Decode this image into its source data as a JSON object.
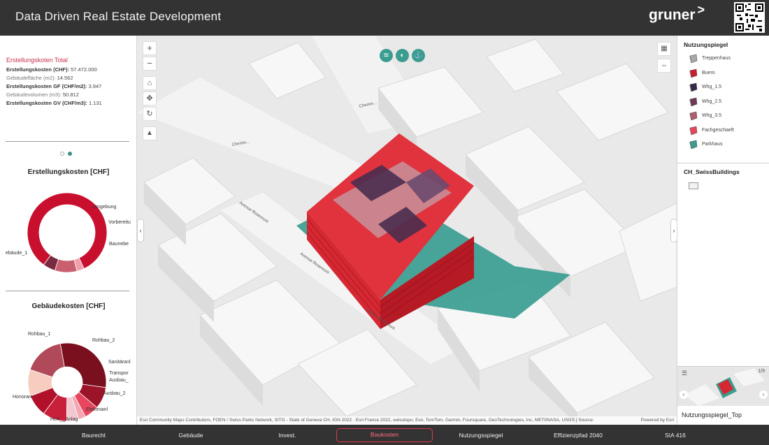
{
  "header": {
    "title": "Data Driven Real Estate Development",
    "logo": "gruner",
    "logo_chevron": ">"
  },
  "stats": {
    "title": "Erstellungskoten Total",
    "rows": [
      {
        "label": "Erstellungskosten (CHF):",
        "value": "57.472.000",
        "bold": true
      },
      {
        "label": "Gebäudefläche (m2):",
        "value": "14.562",
        "bold": false
      },
      {
        "label": "Erstellungskosten GF (CHF/m2):",
        "value": "3.947",
        "bold": true
      },
      {
        "label": "Gebäudevolumen (m3):",
        "value": "50.812",
        "bold": false
      },
      {
        "label": "Erstellungskosten GV (CHF/m3):",
        "value": "1.131",
        "bold": true
      }
    ]
  },
  "charts": {
    "erstellung": {
      "title": "Erstellungskosten [CHF]",
      "labels": [
        "Umgebung",
        "Vorbereitu",
        "Baunebe",
        "ebäude_1"
      ]
    },
    "gebaeude": {
      "title": "Gebäudekosten [CHF]",
      "labels": [
        "Rohbau_1",
        "Rohbau_2",
        "Sanitäranl",
        "Transpor",
        "Ausbau_",
        "Ausbau_2",
        "Elektroanl",
        "HLK__Anlag",
        "Honorare"
      ]
    }
  },
  "chart_data": [
    {
      "type": "pie",
      "title": "Erstellungskosten [CHF]",
      "categories": [
        "Gebäude_1",
        "Umgebung",
        "Vorbereitu",
        "Baunebe"
      ],
      "values": [
        83,
        3,
        9,
        5
      ],
      "colors": [
        "#c8102e",
        "#f0a0aa",
        "#c86070",
        "#7a2a40"
      ]
    },
    {
      "type": "pie",
      "title": "Gebäudekosten [CHF]",
      "categories": [
        "Rohbau_1",
        "Rohbau_2",
        "Sanitäranl",
        "Transpor",
        "Ausbau_",
        "Ausbau_2",
        "Elektroanl",
        "HLK__Anlag",
        "Honorare"
      ],
      "values": [
        30,
        9,
        6,
        3,
        5,
        10,
        9,
        11,
        17
      ],
      "colors": [
        "#7a0f1e",
        "#9b1428",
        "#e8465e",
        "#f5a6b2",
        "#f2c8cf",
        "#c8203a",
        "#b0102a",
        "#f6cdbf",
        "#b04a5a"
      ]
    }
  ],
  "map": {
    "top_tools": [
      "layers-icon",
      "compass-rose-icon",
      "anchor-icon"
    ],
    "streets": [
      "Avenue Rosemont",
      "Avenue Rosemont",
      "Avenue Rosemont",
      "Chemin...",
      "Chemin..."
    ],
    "attribution": "Esri Community Maps Contributors, FOEN / Swiss Parks Network, SITG - State of Geneva CH, IGN 2022 · Esri France 2022, swisstopo, Esri, TomTom, Garmin, Foursquare, GeoTechnologies, Inc, METI/NASA, USGS | Source:",
    "powered_by": "Powered by Esri"
  },
  "legend": {
    "title": "Nutzungspiegel",
    "items": [
      {
        "label": "Treppenhaus",
        "color": "#a8a8a8"
      },
      {
        "label": "Buero",
        "color": "#cc1f2e"
      },
      {
        "label": "Whg_1.5",
        "color": "#3a2a4a"
      },
      {
        "label": "Whg_2.5",
        "color": "#6e3a55"
      },
      {
        "label": "Whg_3.5",
        "color": "#b25a6e"
      },
      {
        "label": "Fachgeschaeft",
        "color": "#e8455a"
      },
      {
        "label": "Parkhaus",
        "color": "#3a9d90"
      }
    ],
    "layer2_title": "CH_SwissBuildings"
  },
  "mini": {
    "pager": "1/9",
    "label": "Nutzungsspiegel_Top"
  },
  "nav": {
    "items": [
      "Baurecht",
      "Gebäude",
      "Invest.",
      "Baukosten",
      "Nutzungsspiegel",
      "Effizienzpfad 2040",
      "SIA 416"
    ],
    "active": "Baukosten"
  }
}
